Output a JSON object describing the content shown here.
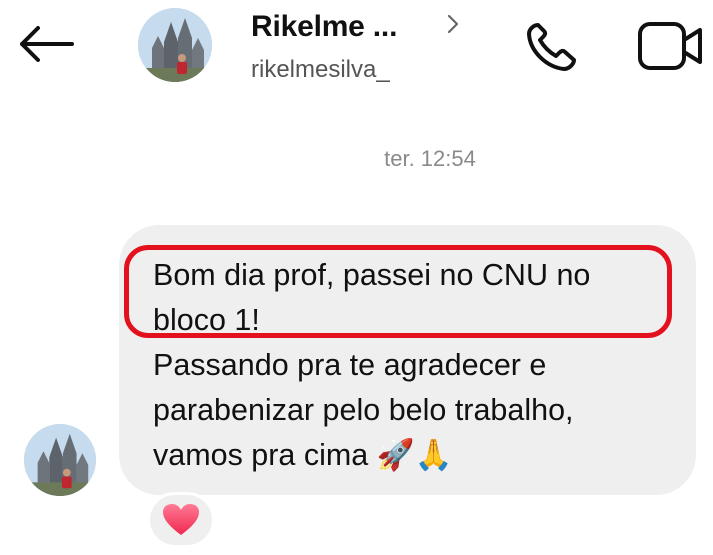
{
  "header": {
    "contact_name": "Rikelme ...",
    "contact_username": "rikelmesilva_"
  },
  "thread": {
    "timestamp": "ter. 12:54"
  },
  "message": {
    "text": "Bom dia prof, passei no CNU no\nbloco 1!\nPassando pra te agradecer e\nparabenizar pelo belo trabalho,\nvamos pra cima 🚀🙏",
    "highlighted_text": "Bom dia prof, passei no CNU no bloco 1!",
    "highlight_color": "#e3101d"
  },
  "reaction": {
    "emoji": "heart-icon"
  },
  "icons": {
    "back": "arrow-left-icon",
    "chevron": "chevron-right-icon",
    "call": "phone-icon",
    "video": "video-camera-icon"
  },
  "colors": {
    "bubble": "#efefef",
    "timestamp": "#8a8a8a",
    "heart": "#ff4d6d"
  }
}
